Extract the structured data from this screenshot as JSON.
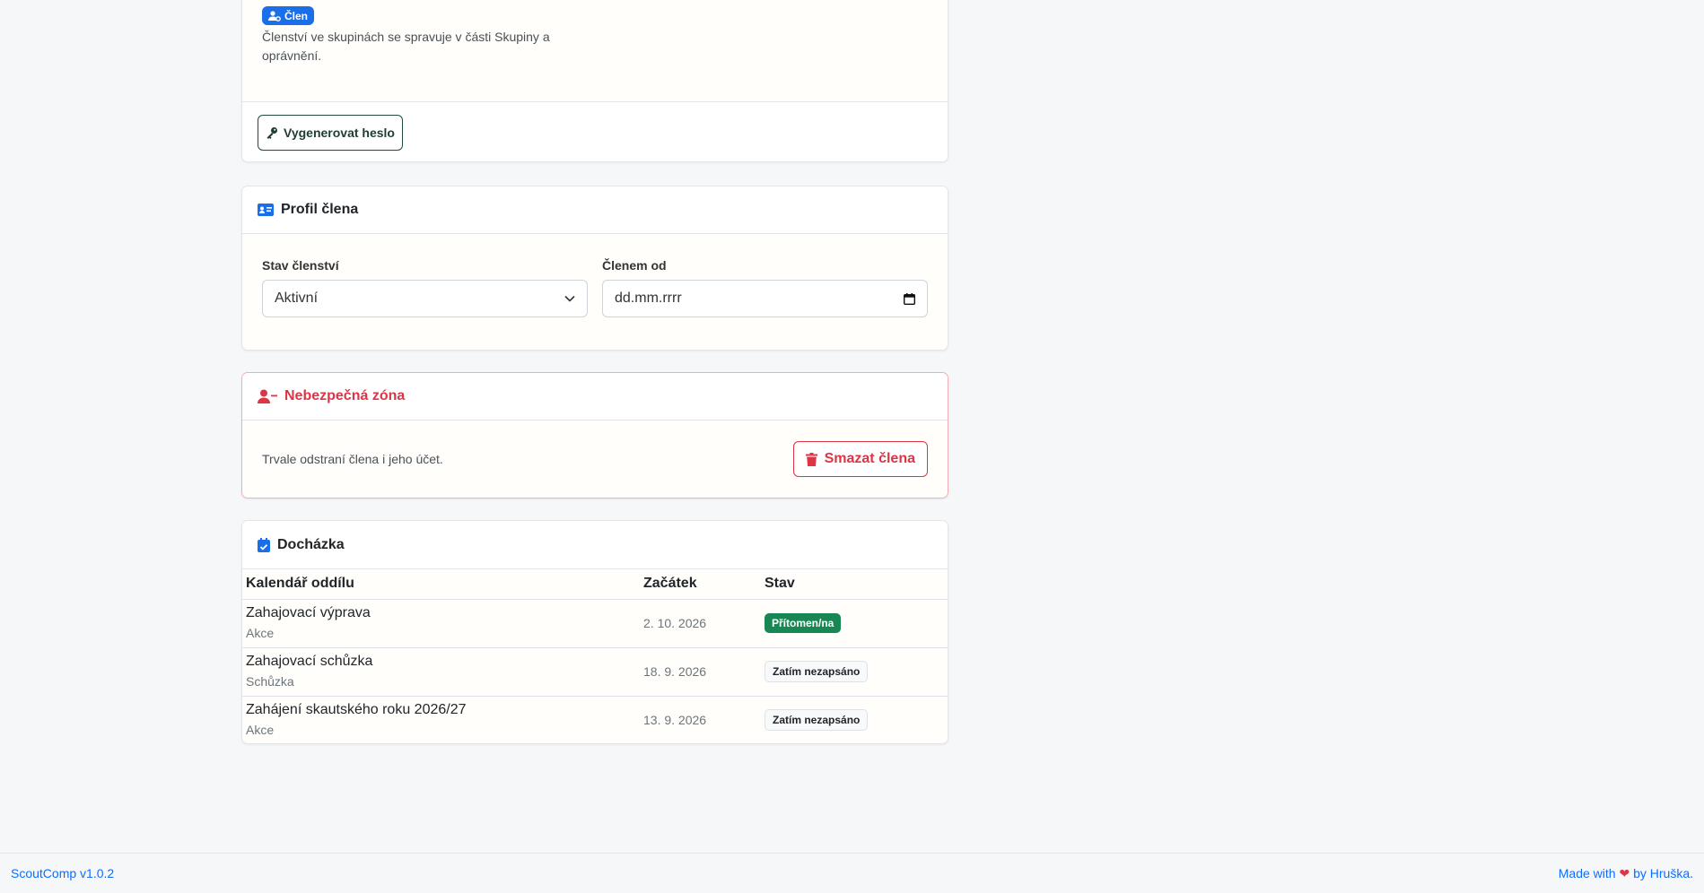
{
  "account": {
    "role_badge": "Člen",
    "membership_note": "Členství ve skupinách se spravuje v části Skupiny a oprávnění.",
    "generate_password_label": "Vygenerovat heslo"
  },
  "profile": {
    "title": "Profil člena",
    "status_label": "Stav členství",
    "status_value": "Aktivní",
    "member_since_label": "Členem od",
    "member_since_placeholder": "dd.mm.rrrr"
  },
  "danger": {
    "title": "Nebezpečná zóna",
    "text": "Trvale odstraní člena i jeho účet.",
    "delete_label": "Smazat člena"
  },
  "attendance": {
    "title": "Docházka",
    "columns": [
      "Kalendář oddílu",
      "Začátek",
      "Stav"
    ],
    "rows": [
      {
        "title": "Zahajovací výprava",
        "type": "Akce",
        "date": "2. 10. 2026",
        "status": "Přítomen/na"
      },
      {
        "title": "Zahajovací schůzka",
        "type": "Schůzka",
        "date": "18. 9. 2026",
        "status": "Zatím nezapsáno"
      },
      {
        "title": "Zahájení skautského roku 2026/27",
        "type": "Akce",
        "date": "13. 9. 2026",
        "status": "Zatím nezapsáno"
      }
    ]
  },
  "footer": {
    "app_version": "ScoutComp v1.0.2",
    "made_with": "Made with",
    "by": "by",
    "author": "Hruška."
  },
  "colors": {
    "primary": "#0d6efd",
    "danger": "#dc3545",
    "success": "#198754"
  }
}
